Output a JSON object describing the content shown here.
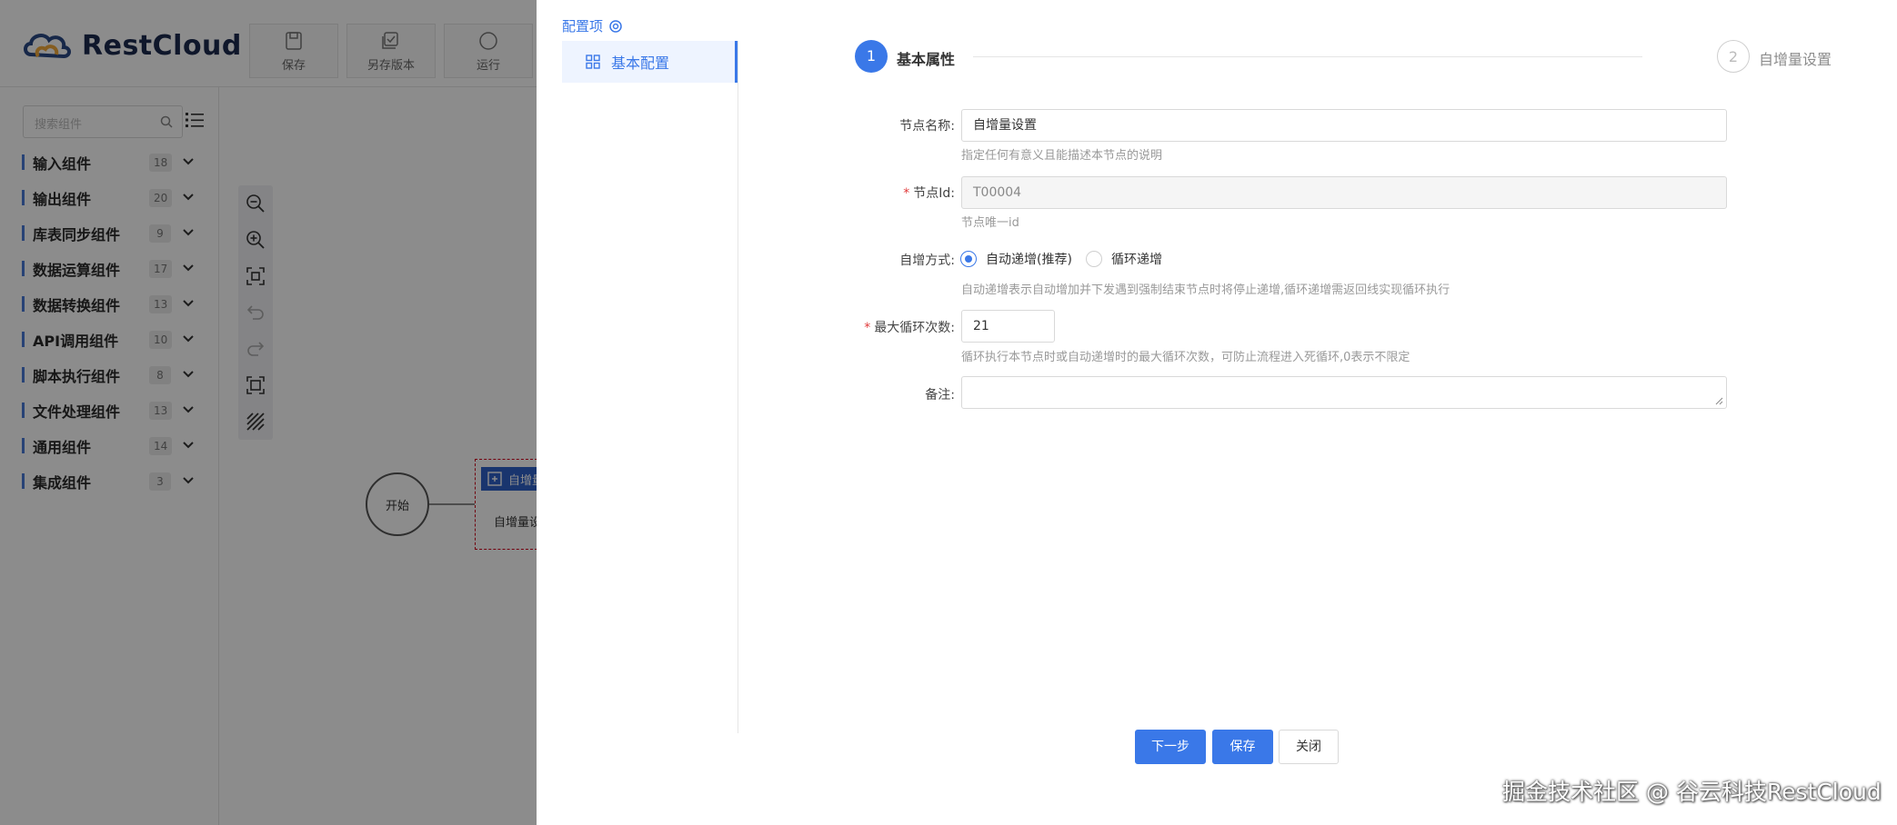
{
  "app": {
    "logo_text": "RestCloud",
    "toolbar": [
      {
        "label": "保存",
        "icon": "save-icon"
      },
      {
        "label": "另存版本",
        "icon": "save-version-icon"
      },
      {
        "label": "运行",
        "icon": "run-icon"
      }
    ]
  },
  "sidebar": {
    "search_placeholder": "搜索组件",
    "categories": [
      {
        "label": "输入组件",
        "count": "18"
      },
      {
        "label": "输出组件",
        "count": "20"
      },
      {
        "label": "库表同步组件",
        "count": "9"
      },
      {
        "label": "数据运算组件",
        "count": "17"
      },
      {
        "label": "数据转换组件",
        "count": "13"
      },
      {
        "label": "API调用组件",
        "count": "10"
      },
      {
        "label": "脚本执行组件",
        "count": "8"
      },
      {
        "label": "文件处理组件",
        "count": "13"
      },
      {
        "label": "通用组件",
        "count": "14"
      },
      {
        "label": "集成组件",
        "count": "3"
      }
    ]
  },
  "canvas": {
    "start_node_label": "开始",
    "task_node_header": "自增量",
    "task_node_label": "自增量设"
  },
  "drawer": {
    "config_title": "配置项",
    "menu_item": "基本配置",
    "steps": [
      {
        "number": "1",
        "label": "基本属性"
      },
      {
        "number": "2",
        "label": "自增量设置"
      }
    ],
    "form": {
      "node_name_label": "节点名称:",
      "node_name_value": "自增量设置",
      "node_name_help": "指定任何有意义且能描述本节点的说明",
      "node_id_label": "节点Id:",
      "node_id_value": "T00004",
      "node_id_help": "节点唯一id",
      "increment_mode_label": "自增方式:",
      "increment_mode_options": [
        "自动递增(推荐)",
        "循环递增"
      ],
      "increment_mode_selected": "自动递增(推荐)",
      "increment_mode_help": "自动递增表示自动增加并下发遇到强制结束节点时将停止递增,循环递增需返回线实现循环执行",
      "max_loop_label": "最大循环次数:",
      "max_loop_value": "21",
      "max_loop_help": "循环执行本节点时或自动递增时的最大循环次数，可防止流程进入死循环,0表示不限定",
      "remark_label": "备注:",
      "remark_value": ""
    },
    "buttons": {
      "next": "下一步",
      "save": "保存",
      "close": "关闭"
    }
  },
  "watermark": "掘金技术社区 @ 谷云科技RestCloud",
  "colors": {
    "accent": "#3a78e8",
    "required": "#e03a3a",
    "overlay": "rgba(0,0,0,0.45)"
  }
}
